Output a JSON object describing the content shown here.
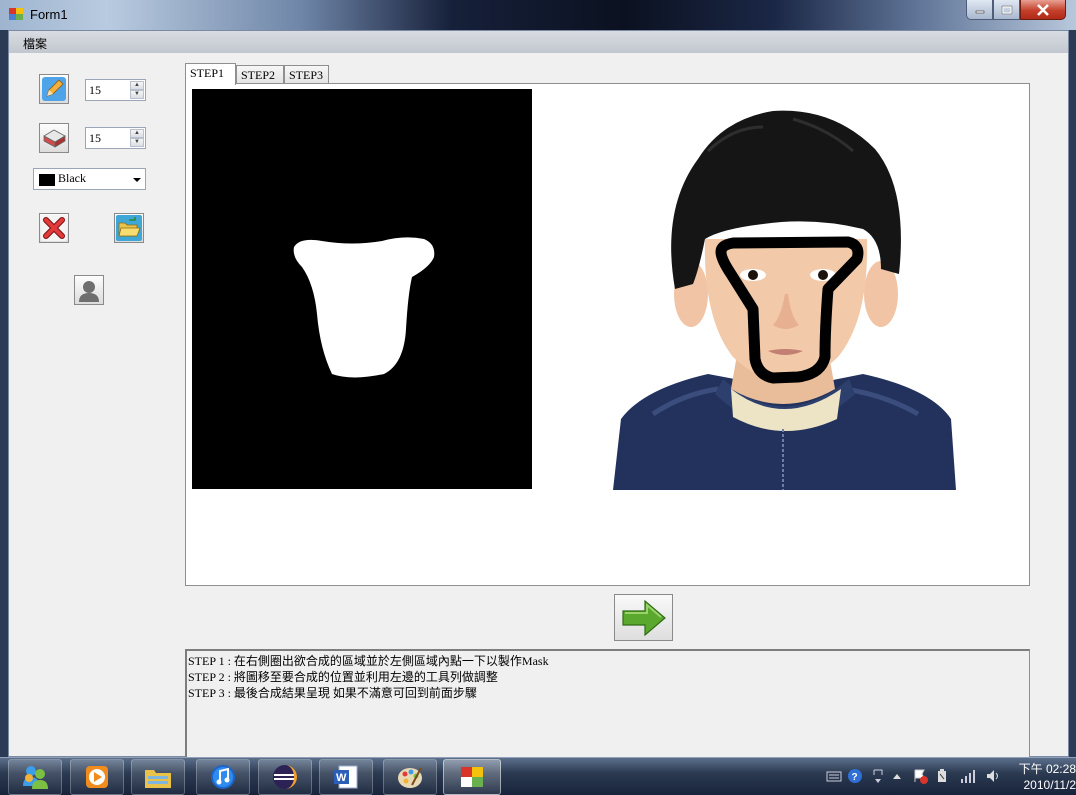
{
  "window": {
    "title": "Form1",
    "menu": {
      "file_label": "檔案"
    }
  },
  "tools": {
    "pen_size": "15",
    "eraser_size": "15",
    "color": {
      "label": "Black",
      "value": "#000000"
    },
    "icons": [
      "pencil-icon",
      "eraser-icon",
      "clear-red-x-icon",
      "open-folder-icon",
      "person-icon"
    ]
  },
  "tabs": [
    {
      "label": "STEP1",
      "active": true
    },
    {
      "label": "STEP2",
      "active": false
    },
    {
      "label": "STEP3",
      "active": false
    }
  ],
  "instructions": [
    "STEP 1 : 在右側圈出欲合成的區域並於左側區域內點一下以製作Mask",
    "STEP 2 : 將圖移至要合成的位置並利用左邊的工具列做調整",
    "STEP 3 : 最後合成結果呈現  如果不滿意可回到前面步驟"
  ],
  "taskbar": {
    "apps": [
      "start-orb",
      "media-player",
      "explorer",
      "itunes",
      "eclipse",
      "word",
      "paint",
      "form1-app"
    ],
    "clock": {
      "time": "下午 02:28",
      "date": "2010/11/2"
    }
  },
  "colors": {
    "mask_bg": "#000000",
    "mask_fg": "#ffffff",
    "arrow_green": "#5aa82e",
    "close_red": "#c4402b"
  }
}
